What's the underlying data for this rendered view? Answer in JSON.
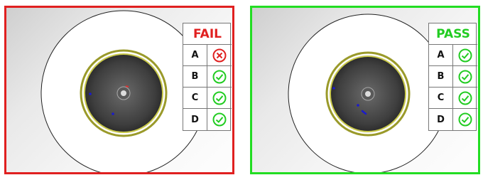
{
  "panels": [
    {
      "id": "fail",
      "status": "FAIL",
      "status_color": "#e02020",
      "border_color": "#e02020",
      "checks": [
        {
          "label": "A",
          "result": "fail",
          "icon": "x-circle-icon"
        },
        {
          "label": "B",
          "result": "pass",
          "icon": "check-circle-icon"
        },
        {
          "label": "C",
          "result": "pass",
          "icon": "check-circle-icon"
        },
        {
          "label": "D",
          "result": "pass",
          "icon": "check-circle-icon"
        }
      ]
    },
    {
      "id": "pass",
      "status": "PASS",
      "status_color": "#22cc22",
      "border_color": "#22dd22",
      "checks": [
        {
          "label": "A",
          "result": "pass",
          "icon": "check-circle-icon"
        },
        {
          "label": "B",
          "result": "pass",
          "icon": "check-circle-icon"
        },
        {
          "label": "C",
          "result": "pass",
          "icon": "check-circle-icon"
        },
        {
          "label": "D",
          "result": "pass",
          "icon": "check-circle-icon"
        }
      ]
    }
  ],
  "colors": {
    "pass_icon": "#22cc22",
    "fail_icon": "#e02020",
    "defect_dot": "#1a1acc",
    "core_ring": "#9a9a2a"
  }
}
